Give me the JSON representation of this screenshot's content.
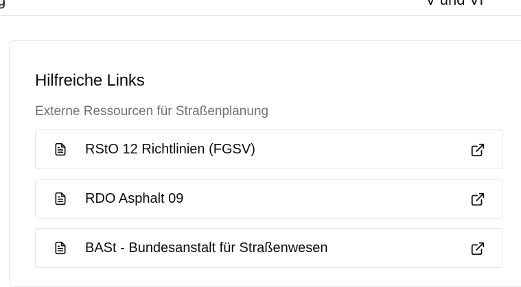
{
  "top_fragment": {
    "left": "g",
    "right": "V und VI"
  },
  "card": {
    "title": "Hilfreiche Links",
    "subtitle": "Externe Ressourcen für Straßenplanung"
  },
  "links": [
    {
      "label": "RStO 12 Richtlinien (FGSV)",
      "icon": "file-text-icon",
      "action_icon": "external-link-icon"
    },
    {
      "label": "RDO Asphalt 09",
      "icon": "file-text-icon",
      "action_icon": "external-link-icon"
    },
    {
      "label": "BASt - Bundesanstalt für Straßenwesen",
      "icon": "file-text-icon",
      "action_icon": "external-link-icon"
    }
  ]
}
